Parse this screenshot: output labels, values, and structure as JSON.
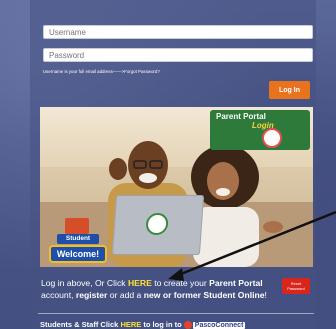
{
  "form": {
    "username_placeholder": "Username",
    "password_placeholder": "Password",
    "hint": "Username is your full email address——>Forgot Password?",
    "login_label": "Log In"
  },
  "banner": {
    "badge_title": "Parent Portal",
    "badge_login": "Login",
    "student_label": "Student",
    "welcome_label": "Welcome!"
  },
  "info": {
    "t1": "Log in above, Or Click ",
    "here": "HERE",
    "t2": " to create your ",
    "pp": "Parent Portal",
    "t3": " account, ",
    "register": "register",
    "t4": " or add a ",
    "new_former": "new or former Student Online",
    "t5": "!"
  },
  "reset_label": "Reset Password",
  "staff": {
    "t1": "Students & Staff Click ",
    "here": "HERE",
    "t2": " to log in to ",
    "brand": "PascoConnect"
  },
  "colors": {
    "accent_orange": "#e8731f",
    "highlight_yellow": "#ffe232",
    "reset_red": "#d9261c"
  }
}
